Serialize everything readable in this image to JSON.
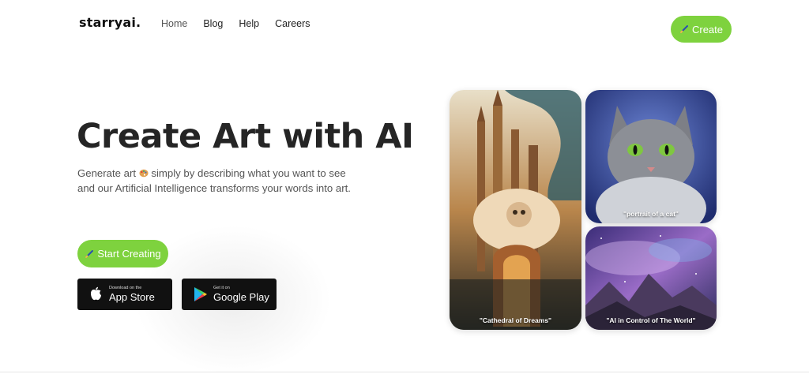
{
  "brand": {
    "logo": "starryai.",
    "accent": "#7ed23e"
  },
  "nav": {
    "items": [
      "Home",
      "Blog",
      "Help",
      "Careers"
    ]
  },
  "header": {
    "create_label": "Create"
  },
  "hero": {
    "title": "Create Art with AI",
    "subtitle_line1_a": "Generate art",
    "subtitle_line1_b": "simply by describing what you want to see",
    "subtitle_line2": "and our Artificial Intelligence transforms your words into art.",
    "cta_label": "Start Creating"
  },
  "stores": {
    "apple": {
      "small": "Download on the",
      "big": "App Store",
      "icon": "apple-icon"
    },
    "google": {
      "small": "Get it on",
      "big": "Google Play",
      "icon": "google-play-icon"
    }
  },
  "gallery": {
    "items": [
      {
        "caption": "\"Cathedral of Dreams\""
      },
      {
        "caption": "\"portrait of a cat\""
      },
      {
        "caption": "\"AI in Control of The World\""
      }
    ]
  }
}
